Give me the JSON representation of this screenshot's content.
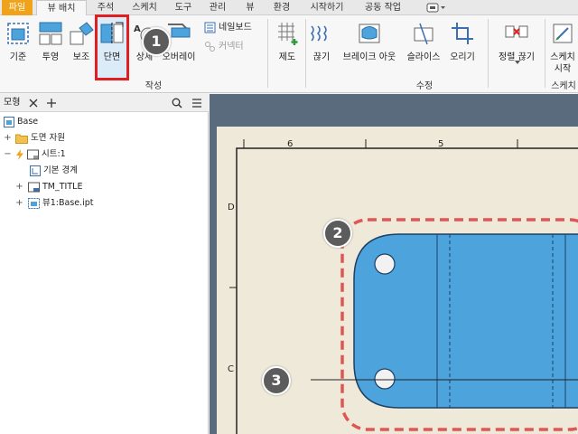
{
  "tabs": [
    {
      "label": "파일",
      "kind": "file"
    },
    {
      "label": "뷰 배치",
      "kind": "active"
    },
    {
      "label": "주석",
      "kind": "normal"
    },
    {
      "label": "스케치",
      "kind": "normal"
    },
    {
      "label": "도구",
      "kind": "normal"
    },
    {
      "label": "관리",
      "kind": "normal"
    },
    {
      "label": "뷰",
      "kind": "normal"
    },
    {
      "label": "환경",
      "kind": "normal"
    },
    {
      "label": "시작하기",
      "kind": "normal"
    },
    {
      "label": "공동 작업",
      "kind": "normal"
    }
  ],
  "ribbon": {
    "create": {
      "label": "작성",
      "base": "기준",
      "projected": "투영",
      "auxiliary": "보조",
      "section": "단면",
      "detail": "상세",
      "overlay": "오버레이",
      "nailboard": "네일보드",
      "connector": "커넥터"
    },
    "modify": {
      "label": "수정",
      "draft": "제도",
      "break": "끊기",
      "breakout": "브레이크 아웃",
      "slice": "슬라이스",
      "crop": "오리기"
    },
    "sketch": {
      "label": "스케치",
      "align_break": "정렬 끊기",
      "start_sketch_1": "스케치",
      "start_sketch_2": "시작"
    }
  },
  "browser": {
    "title": "모형",
    "rows": [
      {
        "label": "Base",
        "icon": "drawing-icon",
        "expander": ""
      },
      {
        "label": "도면 자원",
        "icon": "folder-icon",
        "expander": "+"
      },
      {
        "label": "시트:1",
        "icon": "sheet-icon",
        "expander": "−"
      },
      {
        "label": "기본 경계",
        "icon": "border-icon",
        "expander": ""
      },
      {
        "label": "TM_TITLE",
        "icon": "title-block-icon",
        "expander": "+"
      },
      {
        "label": "뷰1:Base.ipt",
        "icon": "view-icon",
        "expander": "+"
      }
    ]
  },
  "drawing": {
    "top_labels": [
      "6",
      "5"
    ],
    "left_labels": [
      "D",
      "C"
    ]
  },
  "callouts": [
    "1",
    "2",
    "3"
  ],
  "colors": {
    "file_tab": "#f0a21b",
    "highlight": "#e02020",
    "part_fill": "#4da3dc",
    "sheet": "#efe9d9",
    "canvas_bg": "#5a6b7e",
    "selection": "#e05555"
  }
}
